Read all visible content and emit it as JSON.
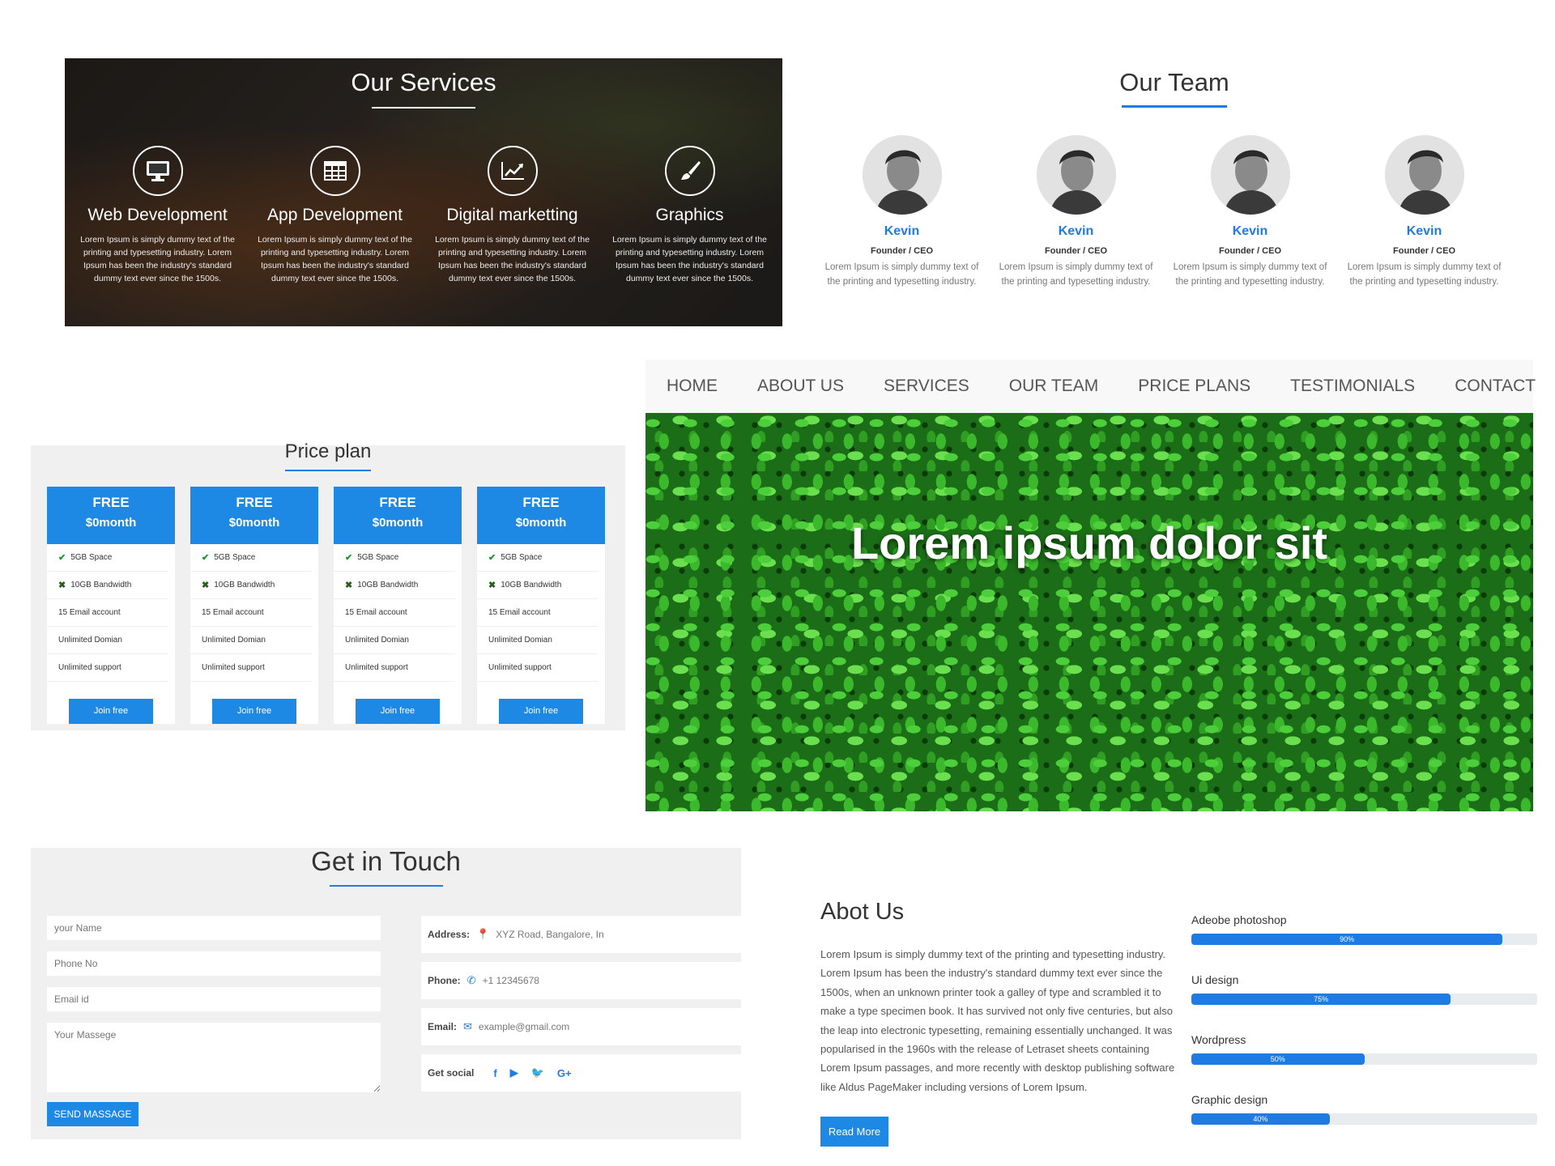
{
  "services": {
    "title": "Our Services",
    "items": [
      {
        "icon": "monitor-icon",
        "title": "Web Development",
        "desc": "Lorem Ipsum is simply dummy text of the printing and typesetting industry. Lorem Ipsum has been the industry's standard dummy text ever since the 1500s."
      },
      {
        "icon": "table-icon",
        "title": "App Development",
        "desc": "Lorem Ipsum is simply dummy text of the printing and typesetting industry. Lorem Ipsum has been the industry's standard dummy text ever since the 1500s."
      },
      {
        "icon": "chart-line-icon",
        "title": "Digital marketting",
        "desc": "Lorem Ipsum is simply dummy text of the printing and typesetting industry. Lorem Ipsum has been the industry's standard dummy text ever since the 1500s."
      },
      {
        "icon": "paintbrush-icon",
        "title": "Graphics",
        "desc": "Lorem Ipsum is simply dummy text of the printing and typesetting industry. Lorem Ipsum has been the industry's standard dummy text ever since the 1500s."
      }
    ]
  },
  "team": {
    "title": "Our Team",
    "members": [
      {
        "name": "Kevin",
        "role": "Founder / CEO",
        "desc": "Lorem Ipsum is simply dummy text of the printing and typesetting industry."
      },
      {
        "name": "Kevin",
        "role": "Founder / CEO",
        "desc": "Lorem Ipsum is simply dummy text of the printing and typesetting industry."
      },
      {
        "name": "Kevin",
        "role": "Founder / CEO",
        "desc": "Lorem Ipsum is simply dummy text of the printing and typesetting industry."
      },
      {
        "name": "Kevin",
        "role": "Founder / CEO",
        "desc": "Lorem Ipsum is simply dummy text of the printing and typesetting industry."
      }
    ]
  },
  "price": {
    "title": "Price plan",
    "plans": [
      {
        "name": "FREE",
        "price": "$0month",
        "features": [
          "5GB Space",
          "10GB Bandwidth",
          "15 Email account",
          "Unlimited Domian",
          "Unlimited support"
        ],
        "button": "Join free"
      },
      {
        "name": "FREE",
        "price": "$0month",
        "features": [
          "5GB Space",
          "10GB Bandwidth",
          "15 Email account",
          "Unlimited Domian",
          "Unlimited support"
        ],
        "button": "Join free"
      },
      {
        "name": "FREE",
        "price": "$0month",
        "features": [
          "5GB Space",
          "10GB Bandwidth",
          "15 Email account",
          "Unlimited Domian",
          "Unlimited support"
        ],
        "button": "Join free"
      },
      {
        "name": "FREE",
        "price": "$0month",
        "features": [
          "5GB Space",
          "10GB Bandwidth",
          "15 Email account",
          "Unlimited Domian",
          "Unlimited support"
        ],
        "button": "Join free"
      }
    ]
  },
  "nav": {
    "items": [
      "HOME",
      "ABOUT US",
      "SERVICES",
      "OUR TEAM",
      "PRICE PLANS",
      "TESTIMONIALS",
      "CONTACT"
    ]
  },
  "hero": {
    "title": "Lorem ipsum dolor sit"
  },
  "contact": {
    "title": "Get in Touch",
    "name_placeholder": "your Name",
    "phone_placeholder": "Phone No",
    "email_placeholder": "Email id",
    "message_placeholder": "Your Massege",
    "send_label": "SEND MASSAGE",
    "address_label": "Address:",
    "address_value": "XYZ Road, Bangalore, In",
    "phone_label": "Phone:",
    "phone_value": "+1 12345678",
    "email_label": "Email:",
    "email_value": "example@gmail.com",
    "social_label": "Get social",
    "social_glyphs": [
      "f",
      "▶",
      "🐦",
      "G+"
    ]
  },
  "about": {
    "title": "Abot Us",
    "text": "Lorem Ipsum is simply dummy text of the printing and typesetting industry. Lorem Ipsum has been the industry's standard dummy text ever since the 1500s, when an unknown printer took a galley of type and scrambled it to make a type specimen book. It has survived not only five centuries, but also the leap into electronic typesetting, remaining essentially unchanged. It was popularised in the 1960s with the release of Letraset sheets containing Lorem Ipsum passages, and more recently with desktop publishing software like Aldus PageMaker including versions of Lorem Ipsum.",
    "button": "Read More"
  },
  "skills": [
    {
      "name": "Adeobe photoshop",
      "value": 90,
      "label": "90%"
    },
    {
      "name": "Ui design",
      "value": 75,
      "label": "75%"
    },
    {
      "name": "Wordpress",
      "value": 50,
      "label": "50%"
    },
    {
      "name": "Graphic design",
      "value": 40,
      "label": "40%"
    }
  ],
  "colors": {
    "accent": "#1e88e5",
    "link_blue": "#1e7be3",
    "section_bg": "#f0f0f0"
  }
}
